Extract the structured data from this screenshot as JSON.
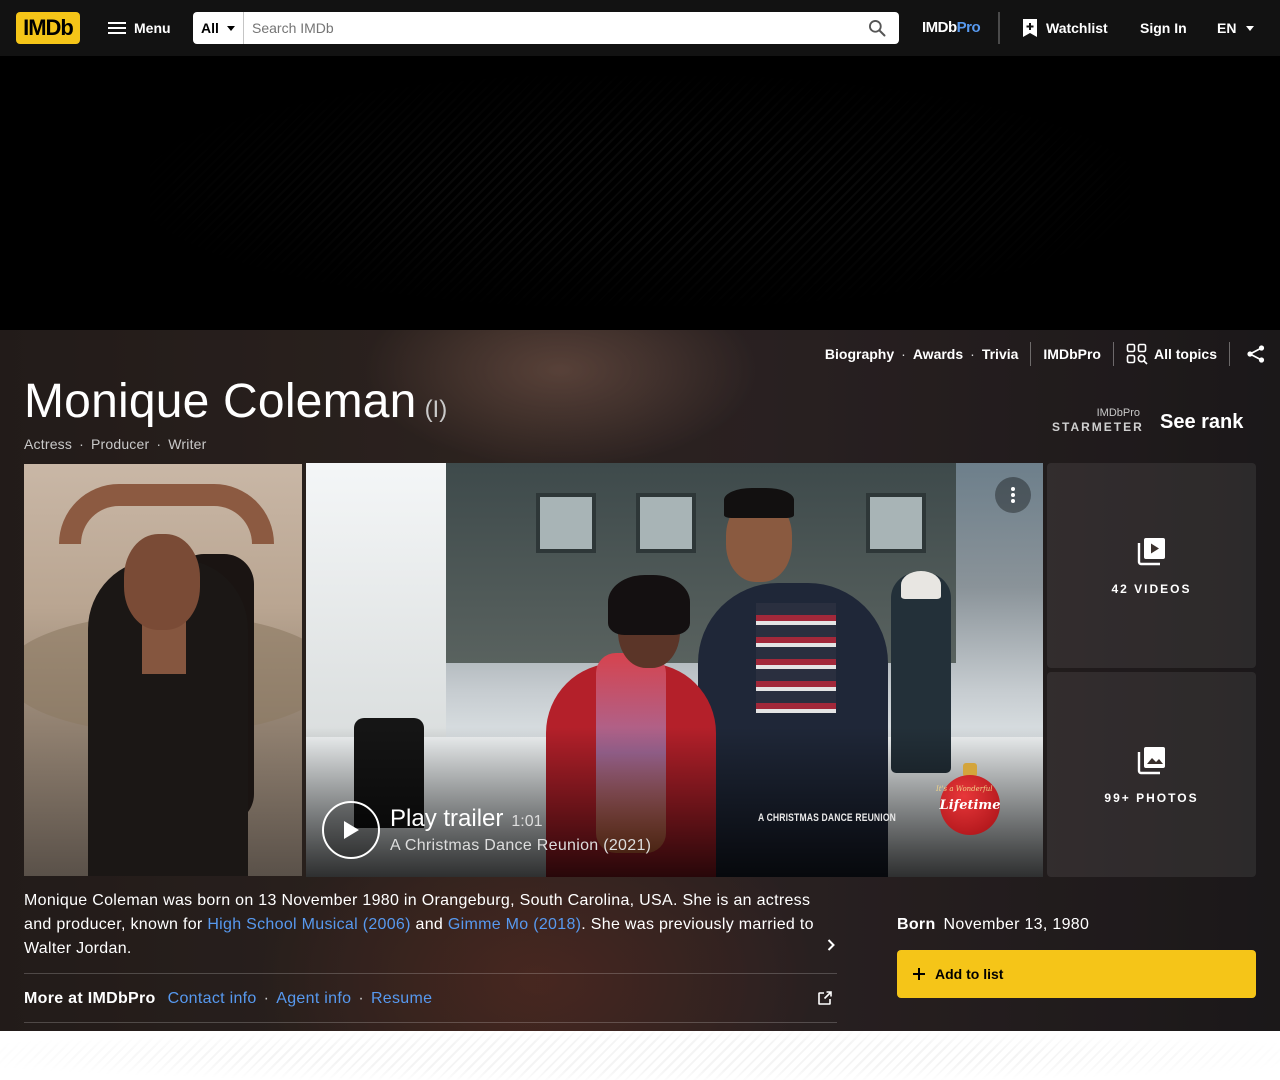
{
  "nav": {
    "logo_text": "IMDb",
    "menu_label": "Menu",
    "search_category": "All",
    "search_placeholder": "Search IMDb",
    "pro_logo_a": "IMDb",
    "pro_logo_b": "Pro",
    "watchlist_label": "Watchlist",
    "signin_label": "Sign In",
    "language": "EN"
  },
  "subnav": {
    "links": [
      "Biography",
      "Awards",
      "Trivia"
    ],
    "imdbpro": "IMDbPro",
    "all_topics": "All topics"
  },
  "person": {
    "name": "Monique Coleman",
    "suffix": "(I)",
    "roles": [
      "Actress",
      "Producer",
      "Writer"
    ]
  },
  "starmeter": {
    "pro": "IMDbPro",
    "label": "STARMETER",
    "action": "See rank"
  },
  "trailer": {
    "label": "Play trailer",
    "duration": "1:01",
    "title": "A Christmas Dance Reunion (2021)",
    "overlay_text": "A CHRISTMAS DANCE REUNION",
    "network_logo": "Lifetime",
    "ornament_tag": "It's a Wonderful"
  },
  "media": {
    "videos_label": "42 VIDEOS",
    "photos_label": "99+ PHOTOS"
  },
  "bio": {
    "part1": "Monique Coleman was born on 13 November 1980 in Orangeburg, South Carolina, USA. She is an actress and producer, known for ",
    "link1": "High School Musical (2006)",
    "part2": " and ",
    "link2": "Gimme Mo (2018)",
    "part3": ". She was previously married to Walter Jordan."
  },
  "more": {
    "label": "More at IMDbPro",
    "links": [
      "Contact info",
      "Agent info",
      "Resume"
    ]
  },
  "born": {
    "label": "Born",
    "value": "November 13, 1980"
  },
  "add_list_label": "Add to list",
  "colors": {
    "brand_yellow": "#f5c518",
    "link_blue": "#5799ef",
    "nav_bg": "#121212"
  }
}
